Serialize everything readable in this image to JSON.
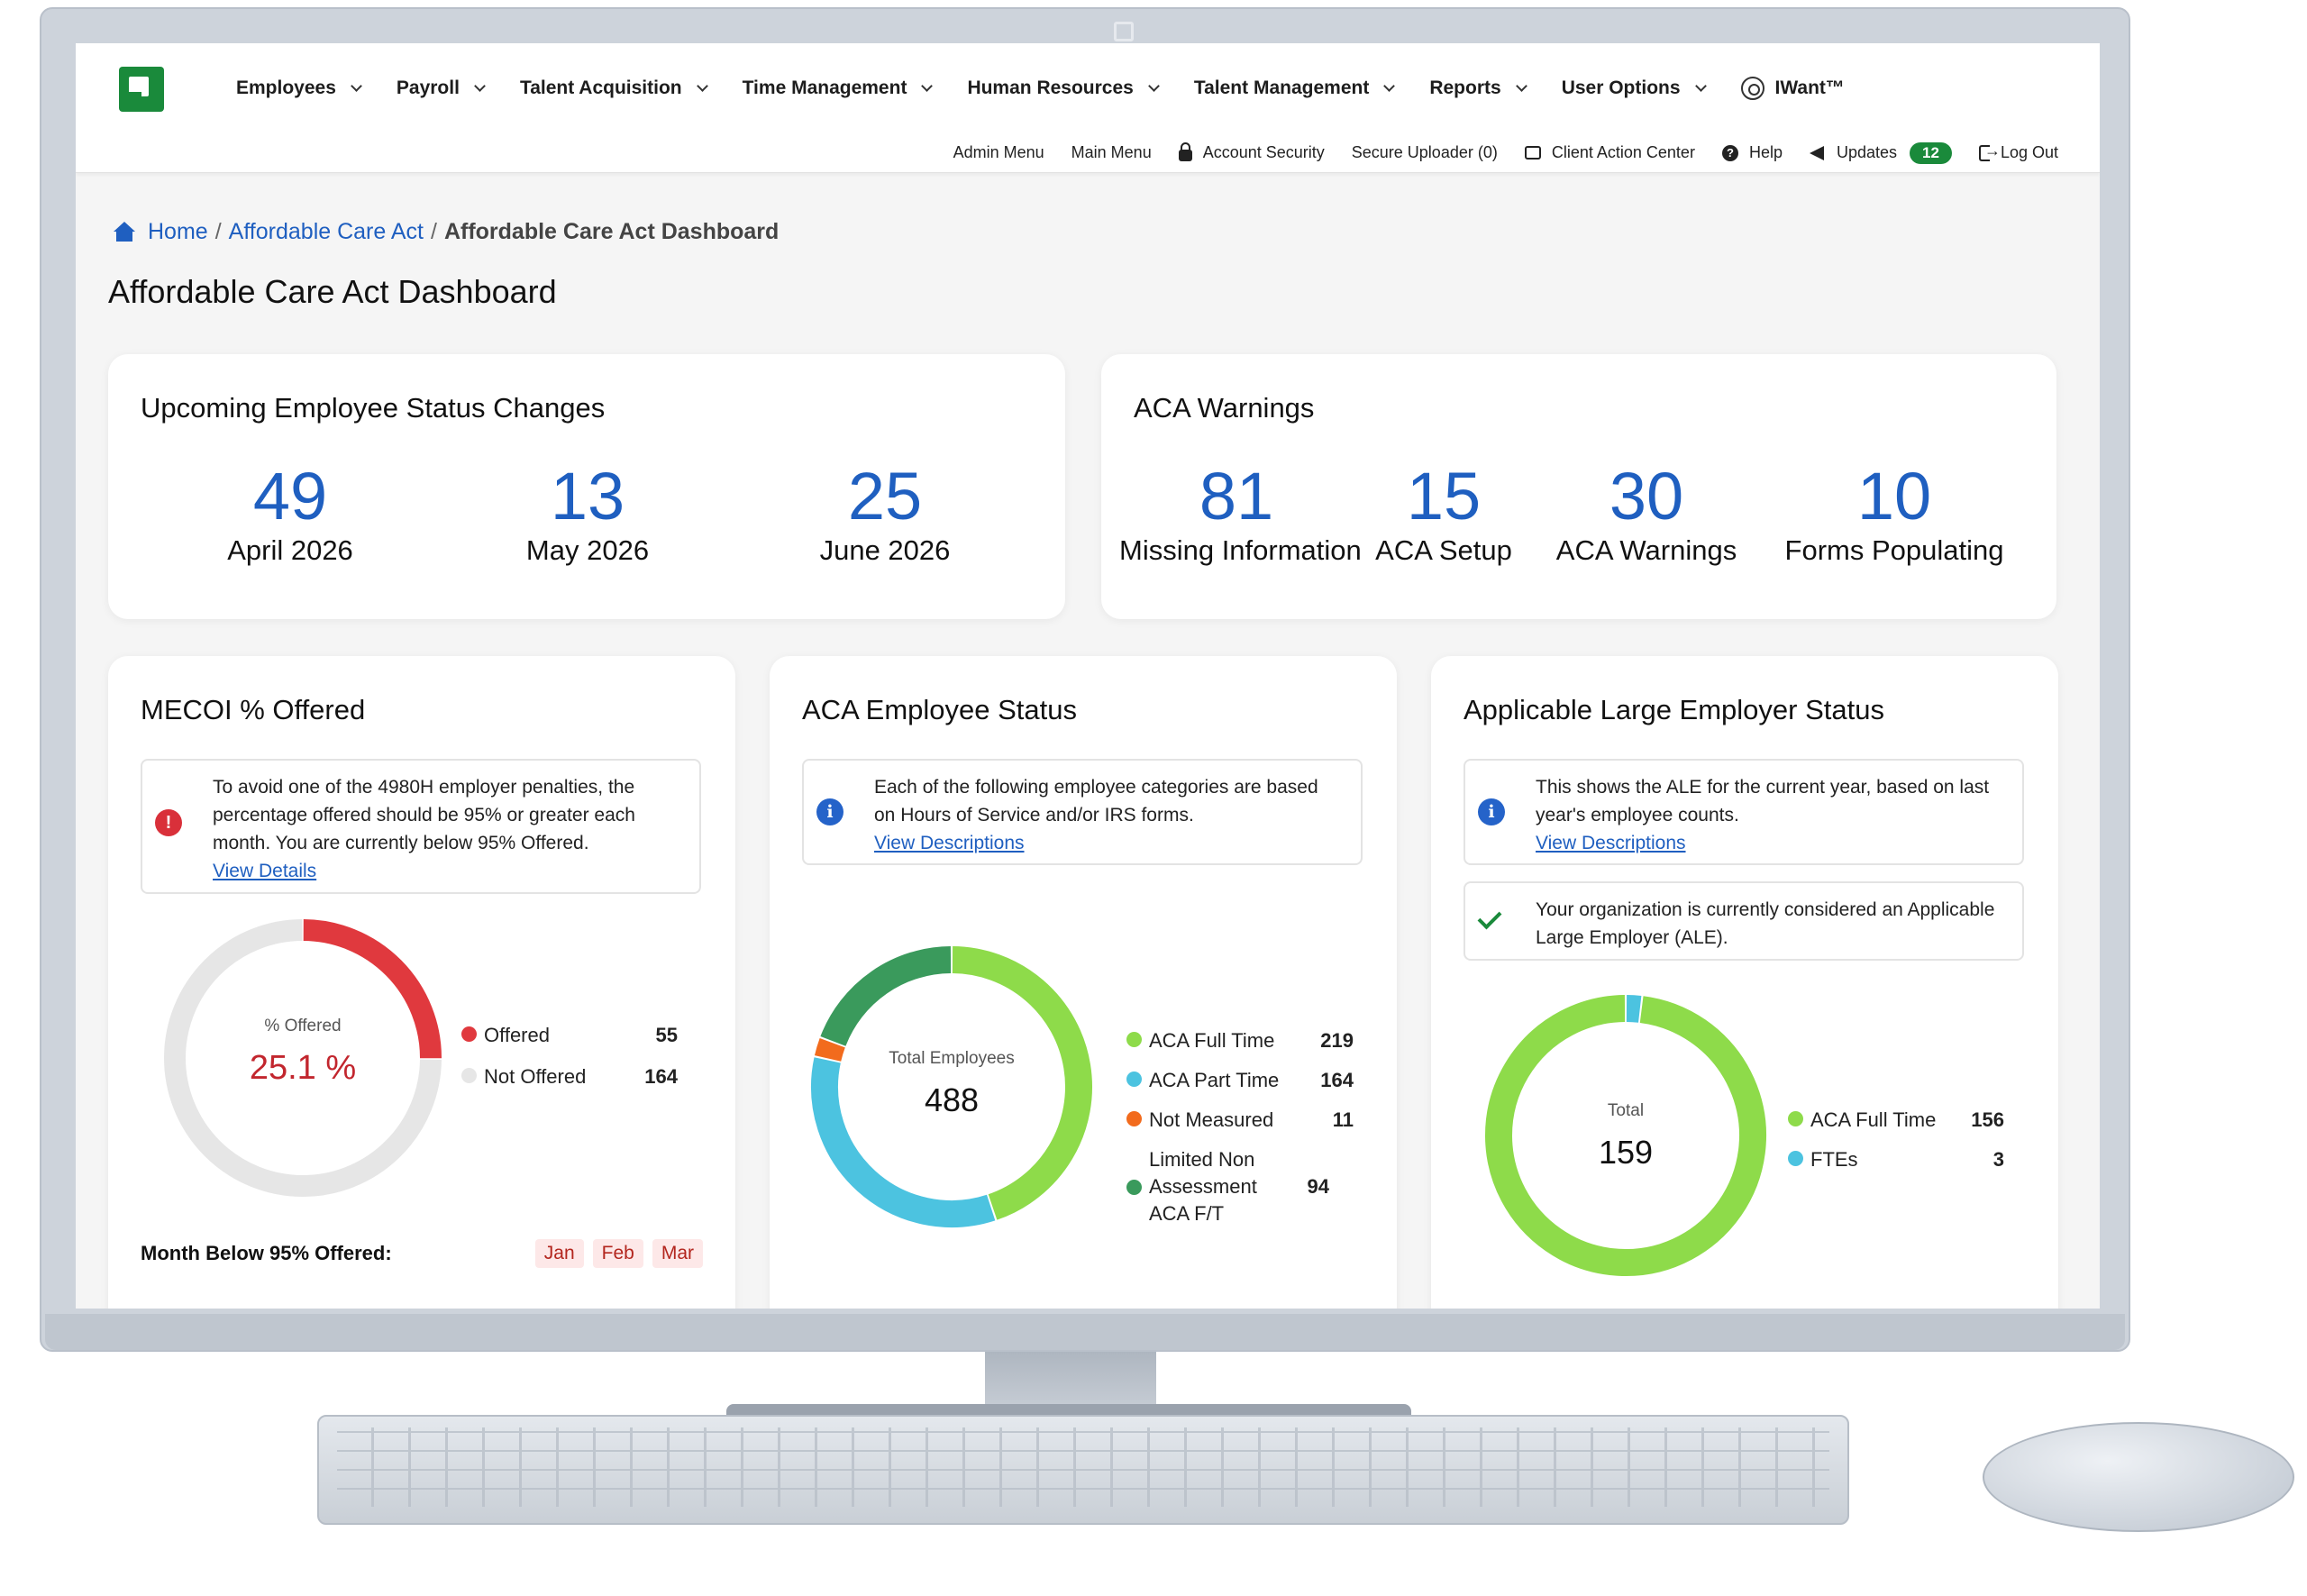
{
  "nav": {
    "menu": [
      {
        "label": "Employees"
      },
      {
        "label": "Payroll"
      },
      {
        "label": "Talent Acquisition"
      },
      {
        "label": "Time Management"
      },
      {
        "label": "Human Resources"
      },
      {
        "label": "Talent Management"
      },
      {
        "label": "Reports"
      },
      {
        "label": "User Options"
      }
    ],
    "iwant": "IWant™",
    "sub": {
      "admin_menu": "Admin Menu",
      "main_menu": "Main Menu",
      "account_security": "Account Security",
      "secure_uploader": "Secure Uploader (0)",
      "client_action_center": "Client Action Center",
      "help": "Help",
      "updates": "Updates",
      "updates_count": "12",
      "log_out": "Log Out"
    }
  },
  "breadcrumb": {
    "home": "Home",
    "aca": "Affordable Care Act",
    "current": "Affordable Care Act Dashboard"
  },
  "page_title": "Affordable Care Act Dashboard",
  "upcoming": {
    "title": "Upcoming Employee Status Changes",
    "stats": [
      {
        "num": "49",
        "label": "April 2026"
      },
      {
        "num": "13",
        "label": "May 2026"
      },
      {
        "num": "25",
        "label": "June 2026"
      }
    ]
  },
  "warnings": {
    "title": "ACA Warnings",
    "stats": [
      {
        "num": "81",
        "label": "Missing Information"
      },
      {
        "num": "15",
        "label": "ACA Setup"
      },
      {
        "num": "30",
        "label": "ACA Warnings"
      },
      {
        "num": "10",
        "label": "Forms Populating"
      }
    ]
  },
  "mecoi": {
    "title": "MECOI % Offered",
    "notice": "To avoid one of the 4980H employer penalties, the percentage offered should be 95% or greater each month. You are currently below 95% Offered.",
    "link": "View Details",
    "center_label": "% Offered",
    "center_value": "25.1 %",
    "legend": [
      {
        "label": "Offered",
        "value": "55",
        "color": "#e0393e"
      },
      {
        "label": "Not Offered",
        "value": "164",
        "color": "#e6e6e6"
      }
    ],
    "months_title": "Month Below 95% Offered:",
    "months": [
      "Jan",
      "Feb",
      "Mar"
    ]
  },
  "status": {
    "title": "ACA Employee Status",
    "notice": "Each of the following employee categories are based on Hours of Service and/or IRS forms.",
    "link": "View Descriptions",
    "center_label": "Total Employees",
    "center_value": "488",
    "legend": [
      {
        "label": "ACA Full Time",
        "value": "219",
        "color": "#8edb4a"
      },
      {
        "label": "ACA Part Time",
        "value": "164",
        "color": "#4cc3e0"
      },
      {
        "label": "Not Measured",
        "value": "11",
        "color": "#f26b1d"
      },
      {
        "label": "Limited Non Assessment ACA F/T",
        "value": "94",
        "color": "#3a9a5c"
      }
    ]
  },
  "ale": {
    "title": "Applicable Large Employer Status",
    "notice": "This shows the ALE for the current year, based on last year's employee counts.",
    "link": "View Descriptions",
    "check": "Your organization is currently considered an Applicable Large Employer (ALE).",
    "center_label": "Total",
    "center_value": "159",
    "legend": [
      {
        "label": "ACA Full Time",
        "value": "156",
        "color": "#8edb4a"
      },
      {
        "label": "FTEs",
        "value": "3",
        "color": "#4cc3e0"
      }
    ]
  }
}
